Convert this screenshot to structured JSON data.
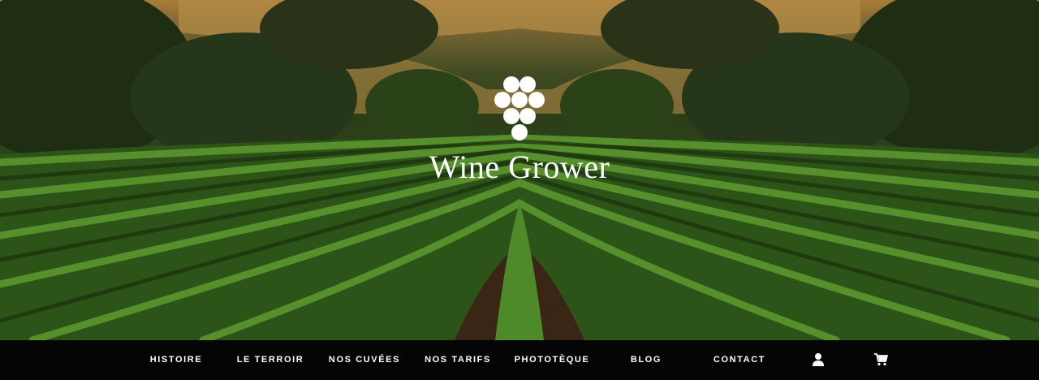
{
  "site": {
    "title": "Wine Grower",
    "logo_icon": "grape-cluster-icon"
  },
  "nav": {
    "items": [
      {
        "label": "HISTOIRE"
      },
      {
        "label": "LE TERROIR"
      },
      {
        "label": "NOS CUVÉES"
      },
      {
        "label": "NOS TARIFS"
      },
      {
        "label": "PHOTOTÈQUE"
      },
      {
        "label": "BLOG"
      },
      {
        "label": "CONTACT"
      }
    ],
    "icons": [
      "user-icon",
      "cart-icon"
    ]
  },
  "colors": {
    "nav_background": "#050505",
    "nav_text": "#ffffff",
    "vine_green": "#3f7a22",
    "sky_gold": "#a97c3a"
  }
}
